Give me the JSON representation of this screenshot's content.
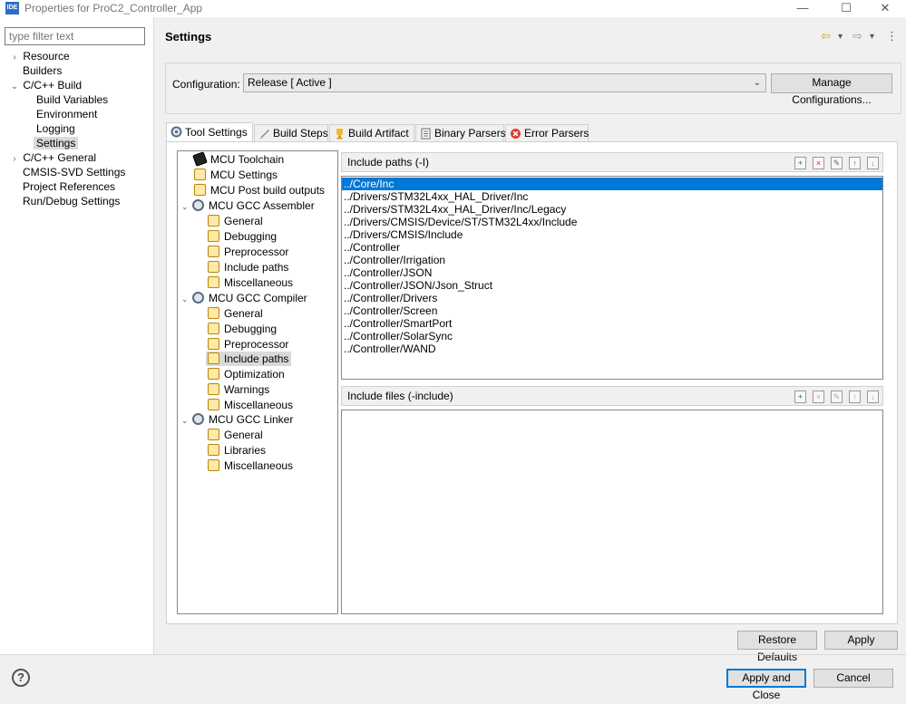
{
  "window": {
    "title": "Properties for ProC2_Controller_App",
    "icon_text": "IDE",
    "minimize": "—",
    "maximize": "☐",
    "close": "✕"
  },
  "filter": {
    "placeholder": "type filter text"
  },
  "nav": [
    {
      "label": "Resource",
      "chevron": "›"
    },
    {
      "label": "Builders",
      "chevron": ""
    },
    {
      "label": "C/C++ Build",
      "chevron": "⌄"
    },
    {
      "label": "Build Variables",
      "chevron": ""
    },
    {
      "label": "Environment",
      "chevron": ""
    },
    {
      "label": "Logging",
      "chevron": ""
    },
    {
      "label": "Settings",
      "chevron": ""
    },
    {
      "label": "C/C++ General",
      "chevron": "›"
    },
    {
      "label": "CMSIS-SVD Settings",
      "chevron": ""
    },
    {
      "label": "Project References",
      "chevron": ""
    },
    {
      "label": "Run/Debug Settings",
      "chevron": ""
    }
  ],
  "page": {
    "title": "Settings",
    "back": "⇦",
    "forward": "⇨",
    "dropdown": "▾",
    "menu": "⋮"
  },
  "configuration": {
    "label": "Configuration:",
    "value": "Release  [ Active ]",
    "manage_label": "Manage Configurations..."
  },
  "tabs": [
    {
      "label": "Tool Settings"
    },
    {
      "label": "Build Steps"
    },
    {
      "label": "Build Artifact"
    },
    {
      "label": "Binary Parsers"
    },
    {
      "label": "Error Parsers"
    }
  ],
  "tool_tree": [
    {
      "label": "MCU Toolchain"
    },
    {
      "label": "MCU Settings"
    },
    {
      "label": "MCU Post build outputs"
    },
    {
      "label": "MCU GCC Assembler",
      "twisty": "⌄"
    },
    {
      "label": "General"
    },
    {
      "label": "Debugging"
    },
    {
      "label": "Preprocessor"
    },
    {
      "label": "Include paths"
    },
    {
      "label": "Miscellaneous"
    },
    {
      "label": "MCU GCC Compiler",
      "twisty": "⌄"
    },
    {
      "label": "General"
    },
    {
      "label": "Debugging"
    },
    {
      "label": "Preprocessor"
    },
    {
      "label": "Include paths"
    },
    {
      "label": "Optimization"
    },
    {
      "label": "Warnings"
    },
    {
      "label": "Miscellaneous"
    },
    {
      "label": "MCU GCC Linker",
      "twisty": "⌄"
    },
    {
      "label": "General"
    },
    {
      "label": "Libraries"
    },
    {
      "label": "Miscellaneous"
    }
  ],
  "include_paths": {
    "header": "Include paths (-I)",
    "items": [
      "../Core/Inc",
      "../Drivers/STM32L4xx_HAL_Driver/Inc",
      "../Drivers/STM32L4xx_HAL_Driver/Inc/Legacy",
      "../Drivers/CMSIS/Device/ST/STM32L4xx/Include",
      "../Drivers/CMSIS/Include",
      "../Controller",
      "../Controller/Irrigation",
      "../Controller/JSON",
      "../Controller/JSON/Json_Struct",
      "../Controller/Drivers",
      "../Controller/Screen",
      "../Controller/SmartPort",
      "../Controller/SolarSync",
      "../Controller/WAND"
    ]
  },
  "include_files": {
    "header": "Include files (-include)"
  },
  "list_toolbar": {
    "add": "+",
    "delete": "×",
    "edit": "✎",
    "move_up": "↑",
    "move_down": "↓"
  },
  "buttons": {
    "restore_defaults": "Restore Defaults",
    "apply": "Apply",
    "apply_close": "Apply and Close",
    "cancel": "Cancel",
    "help": "?"
  }
}
